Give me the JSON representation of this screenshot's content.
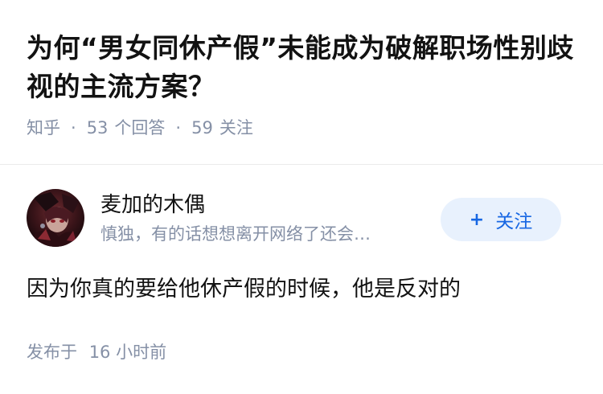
{
  "question": {
    "title": "为何“男女同休产假”未能成为破解职场性别歧视的主流方案？",
    "source": "知乎",
    "separator": "·",
    "answers_count": "53",
    "answers_label": "个回答",
    "followers_count": "59",
    "followers_label": "关注"
  },
  "author": {
    "name": "麦加的木偶",
    "bio": "慎独，有的话想想离开网络了还会…",
    "avatar_icon": "avatar-dark-anime-character"
  },
  "follow_button": {
    "icon": "plus-icon",
    "plus_symbol": "+",
    "label": "关注"
  },
  "answer": {
    "content": "因为你真的要给他休产假的时候，他是反对的",
    "published_label": "发布于",
    "published_time": "16 小时前"
  },
  "colors": {
    "primary_text": "#121212",
    "secondary_text": "#8590a6",
    "accent": "#1767e3",
    "accent_bg": "#e8f1fd",
    "divider": "#ebebeb"
  }
}
